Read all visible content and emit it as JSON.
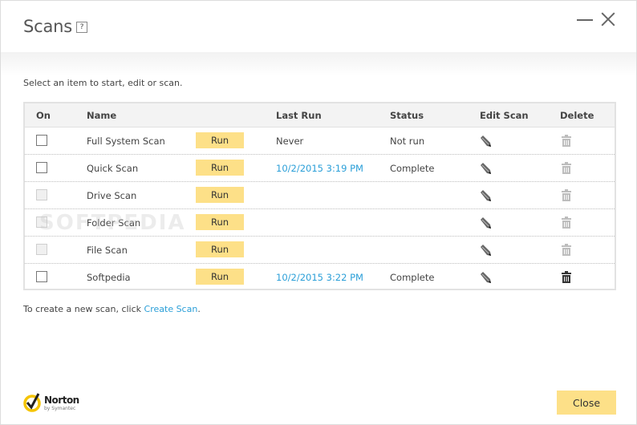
{
  "window": {
    "title": "Scans",
    "help_label": "?",
    "minimize_icon": "minimize-icon",
    "close_icon": "close-icon"
  },
  "instruction": "Select an item to start, edit or scan.",
  "table": {
    "headers": {
      "on": "On",
      "name": "Name",
      "last_run": "Last Run",
      "status": "Status",
      "edit": "Edit Scan",
      "delete": "Delete"
    },
    "rows": [
      {
        "name": "Full System Scan",
        "run_label": "Run",
        "last_run": "Never",
        "last_run_is_link": false,
        "status": "Not run",
        "checkbox_enabled": true,
        "checked": false,
        "delete_enabled": false
      },
      {
        "name": "Quick Scan",
        "run_label": "Run",
        "last_run": "10/2/2015 3:19 PM",
        "last_run_is_link": true,
        "status": "Complete",
        "checkbox_enabled": true,
        "checked": false,
        "delete_enabled": false
      },
      {
        "name": "Drive Scan",
        "run_label": "Run",
        "last_run": "",
        "last_run_is_link": false,
        "status": "",
        "checkbox_enabled": false,
        "checked": false,
        "delete_enabled": false
      },
      {
        "name": "Folder Scan",
        "run_label": "Run",
        "last_run": "",
        "last_run_is_link": false,
        "status": "",
        "checkbox_enabled": false,
        "checked": false,
        "delete_enabled": false
      },
      {
        "name": "File Scan",
        "run_label": "Run",
        "last_run": "",
        "last_run_is_link": false,
        "status": "",
        "checkbox_enabled": false,
        "checked": false,
        "delete_enabled": false
      },
      {
        "name": "Softpedia",
        "run_label": "Run",
        "last_run": "10/2/2015 3:22 PM",
        "last_run_is_link": true,
        "status": "Complete",
        "checkbox_enabled": true,
        "checked": false,
        "delete_enabled": true
      }
    ]
  },
  "footer": {
    "create_prefix": "To create a new scan, click ",
    "create_link": "Create Scan",
    "create_suffix": ".",
    "close_label": "Close"
  },
  "logo": {
    "name": "Norton",
    "sub": "by Symantec"
  },
  "watermark": "SOFTPEDIA",
  "colors": {
    "accent_button": "#fde088",
    "link": "#2b9fd8"
  }
}
